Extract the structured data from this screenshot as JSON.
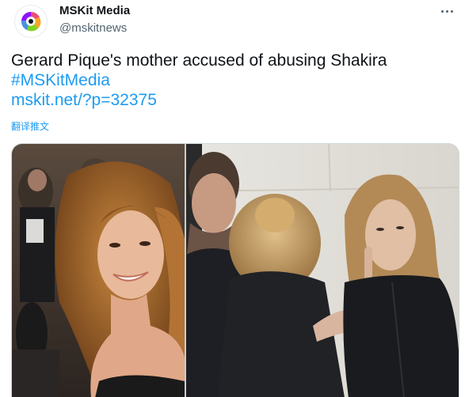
{
  "author": {
    "display_name": "MSKit Media",
    "handle": "@mskitnews",
    "avatar_icon": "colorful-circle-logo"
  },
  "more_icon": "ellipsis-icon",
  "tweet": {
    "text": "Gerard Pique's mother accused of abusing Shakira",
    "hashtag": "#MSKitMedia",
    "link": "mskit.net/?p=32375",
    "translate_label": "翻译推文"
  },
  "colors": {
    "link": "#1d9bf0",
    "text": "#0f1419",
    "secondary": "#536471",
    "border": "#cfd9de"
  },
  "media": [
    {
      "kind": "photo",
      "subject": "smiling woman with long wavy hair at red carpet"
    },
    {
      "kind": "photo",
      "subject": "woman with finger to lips facing blonde woman, man in background"
    }
  ]
}
